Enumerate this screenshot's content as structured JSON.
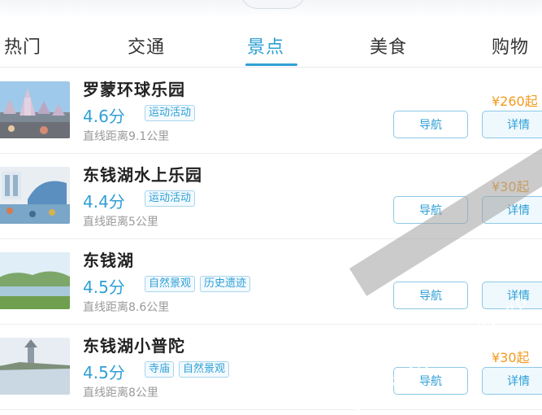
{
  "tabs": [
    "热门",
    "交通",
    "景点",
    "美食",
    "购物"
  ],
  "active_tab": "景点",
  "items": [
    {
      "name": "罗蒙环球乐园",
      "score": "4.6分",
      "tags": [
        "运动活动"
      ],
      "distance": "直线距离9.1公里",
      "price": "¥260起",
      "nav_label": "导航",
      "detail_label": "详情"
    },
    {
      "name": "东钱湖水上乐园",
      "score": "4.4分",
      "tags": [
        "运动活动"
      ],
      "distance": "直线距离5公里",
      "price": "¥30起",
      "nav_label": "导航",
      "detail_label": "详情"
    },
    {
      "name": "东钱湖",
      "score": "4.5分",
      "tags": [
        "自然景观",
        "历史遗迹"
      ],
      "distance": "直线距离8.6公里",
      "price": "",
      "nav_label": "导航",
      "detail_label": "详情"
    },
    {
      "name": "东钱湖小普陀",
      "score": "4.5分",
      "tags": [
        "寺庙",
        "自然景观"
      ],
      "distance": "直线距离8公里",
      "price": "¥30起",
      "nav_label": "导航",
      "detail_label": "详情"
    }
  ],
  "watermark": "COPYRIGHT RESERVERD",
  "colors": {
    "accent": "#2f9fd6",
    "price": "#f29a1f",
    "text": "#222222",
    "muted": "#9a9a9a"
  }
}
